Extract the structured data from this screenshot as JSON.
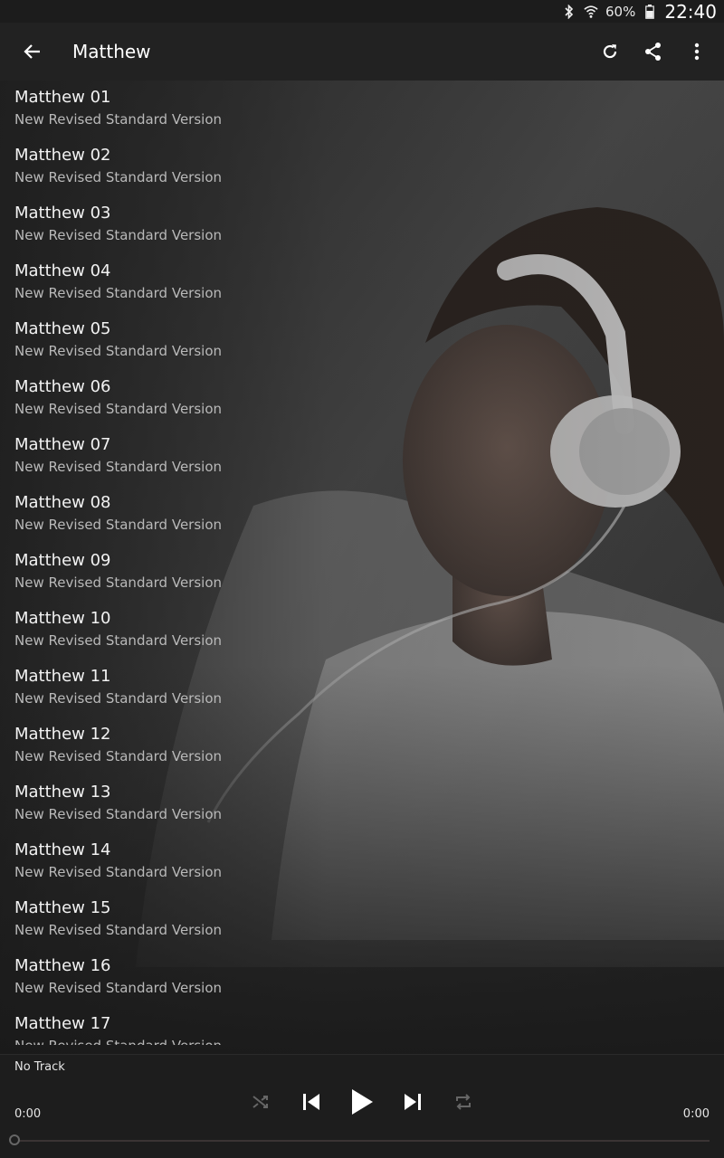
{
  "status_bar": {
    "battery": "60%",
    "time": "22:40"
  },
  "app_bar": {
    "title": "Matthew"
  },
  "tracks": [
    {
      "title": "Matthew 01",
      "subtitle": "New Revised Standard Version"
    },
    {
      "title": "Matthew 02",
      "subtitle": "New Revised Standard Version"
    },
    {
      "title": "Matthew 03",
      "subtitle": "New Revised Standard Version"
    },
    {
      "title": "Matthew 04",
      "subtitle": "New Revised Standard Version"
    },
    {
      "title": "Matthew 05",
      "subtitle": "New Revised Standard Version"
    },
    {
      "title": "Matthew 06",
      "subtitle": "New Revised Standard Version"
    },
    {
      "title": "Matthew 07",
      "subtitle": "New Revised Standard Version"
    },
    {
      "title": "Matthew 08",
      "subtitle": "New Revised Standard Version"
    },
    {
      "title": "Matthew 09",
      "subtitle": "New Revised Standard Version"
    },
    {
      "title": "Matthew 10",
      "subtitle": "New Revised Standard Version"
    },
    {
      "title": "Matthew 11",
      "subtitle": "New Revised Standard Version"
    },
    {
      "title": "Matthew 12",
      "subtitle": "New Revised Standard Version"
    },
    {
      "title": "Matthew 13",
      "subtitle": "New Revised Standard Version"
    },
    {
      "title": "Matthew 14",
      "subtitle": "New Revised Standard Version"
    },
    {
      "title": "Matthew 15",
      "subtitle": "New Revised Standard Version"
    },
    {
      "title": "Matthew 16",
      "subtitle": "New Revised Standard Version"
    },
    {
      "title": "Matthew 17",
      "subtitle": "New Revised Standard Version"
    }
  ],
  "player": {
    "now_playing": "No Track",
    "elapsed": "0:00",
    "duration": "0:00",
    "progress": 0
  },
  "colors": {
    "status_bar_bg": "#1c1c1c",
    "app_bar_bg": "#222222",
    "player_bg": "#1d1d1d",
    "seek_track": "#3a3434"
  }
}
